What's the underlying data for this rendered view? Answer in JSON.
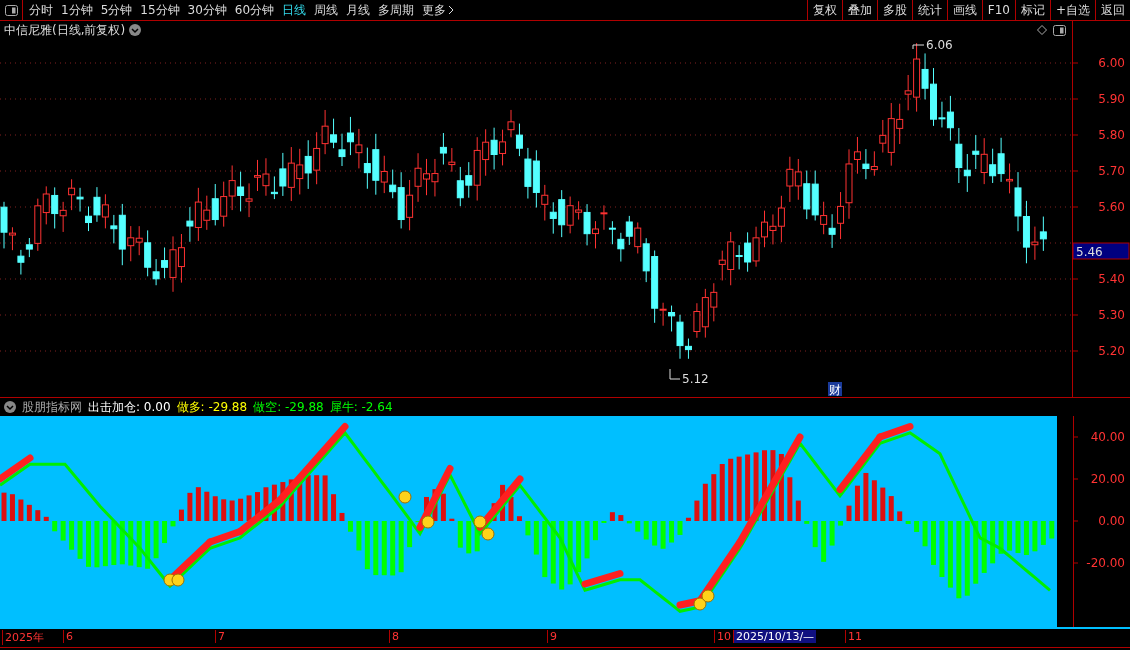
{
  "toolbar": {
    "periods": [
      {
        "label": "分时",
        "selected": false
      },
      {
        "label": "1分钟",
        "selected": false
      },
      {
        "label": "5分钟",
        "selected": false
      },
      {
        "label": "15分钟",
        "selected": false
      },
      {
        "label": "30分钟",
        "selected": false
      },
      {
        "label": "60分钟",
        "selected": false
      },
      {
        "label": "日线",
        "selected": true
      },
      {
        "label": "周线",
        "selected": false
      },
      {
        "label": "月线",
        "selected": false
      },
      {
        "label": "多周期",
        "selected": false
      },
      {
        "label": "更多",
        "selected": false
      }
    ],
    "buttons": [
      "复权",
      "叠加",
      "多股",
      "统计",
      "画线",
      "F10",
      "标记",
      "+自选",
      "返回"
    ]
  },
  "price_chart": {
    "title": "中信尼雅(日线,前复权)",
    "high_marker": "6.06",
    "low_marker": "5.12",
    "event_badge": "财",
    "axis_labels": [
      "6.00",
      "5.90",
      "5.80",
      "5.70",
      "5.60",
      "5.40",
      "5.30",
      "5.20"
    ],
    "last_price": "5.46"
  },
  "indicator": {
    "name": "股朋指标网",
    "readings": [
      {
        "text": "出击加仓: 0.00",
        "color": "#ffffff"
      },
      {
        "text": "做多: -29.88",
        "color": "#ffff00"
      },
      {
        "text": "做空: -29.88",
        "color": "#00ff00"
      },
      {
        "text": "犀牛: -2.64",
        "color": "#00ff00"
      }
    ],
    "axis_labels": [
      "40.00",
      "20.00",
      "0.00",
      "-20.00"
    ]
  },
  "date_axis": {
    "labels": [
      {
        "text": "2025年",
        "selected": false
      },
      {
        "text": "6",
        "selected": false
      },
      {
        "text": "7",
        "selected": false
      },
      {
        "text": "8",
        "selected": false
      },
      {
        "text": "9",
        "selected": false
      },
      {
        "text": "10",
        "selected": false
      },
      {
        "text": "2025/10/13/—",
        "selected": true
      },
      {
        "text": "11",
        "selected": false
      }
    ]
  }
}
